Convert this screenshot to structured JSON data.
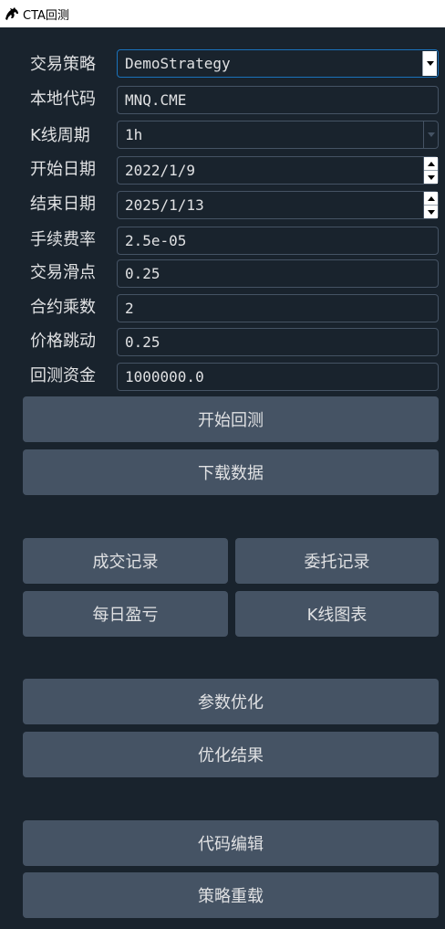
{
  "window": {
    "title": "CTA回测"
  },
  "form": {
    "strategy": {
      "label": "交易策略",
      "value": "DemoStrategy"
    },
    "symbol": {
      "label": "本地代码",
      "value": "MNQ.CME"
    },
    "interval": {
      "label": "K线周期",
      "value": "1h"
    },
    "start_date": {
      "label": "开始日期",
      "value": "2022/1/9"
    },
    "end_date": {
      "label": "结束日期",
      "value": "2025/1/13"
    },
    "rate": {
      "label": "手续费率",
      "value": "2.5e-05"
    },
    "slippage": {
      "label": "交易滑点",
      "value": "0.25"
    },
    "size": {
      "label": "合约乘数",
      "value": "2"
    },
    "pricetick": {
      "label": "价格跳动",
      "value": "0.25"
    },
    "capital": {
      "label": "回测资金",
      "value": "1000000.0"
    }
  },
  "buttons": {
    "start_backtest": "开始回测",
    "download_data": "下载数据",
    "trade_records": "成交记录",
    "order_records": "委托记录",
    "daily_pnl": "每日盈亏",
    "kline_chart": "K线图表",
    "optimize": "参数优化",
    "optimize_result": "优化结果",
    "edit_code": "代码编辑",
    "reload_strategy": "策略重载"
  },
  "icons": {
    "app_logo": "horse-logo-icon",
    "dropdown": "triangle-down-icon",
    "spin_up": "triangle-up-icon",
    "spin_down": "triangle-down-icon"
  },
  "colors": {
    "background": "#19232d",
    "button": "#455364",
    "border": "#455364",
    "focus_border": "#1a72bb",
    "text": "#e0e1e3"
  }
}
